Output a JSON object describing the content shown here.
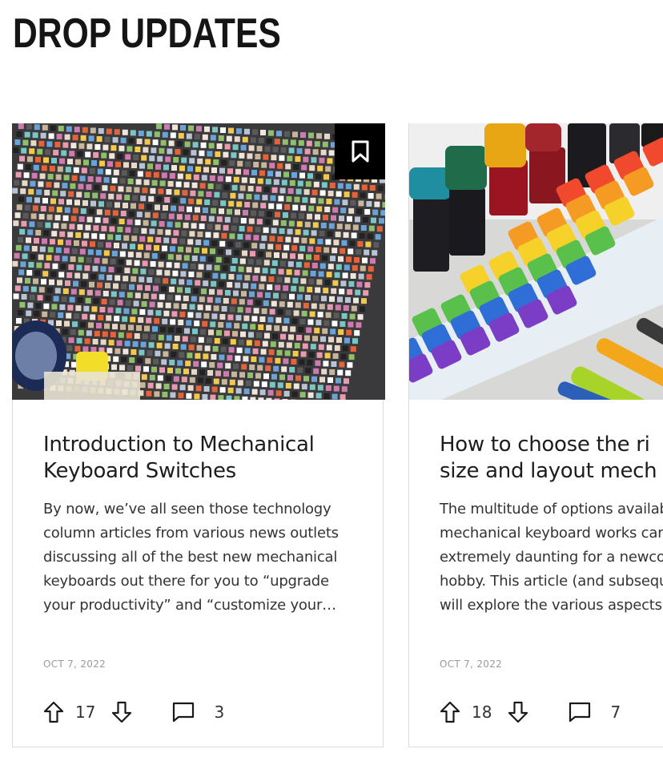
{
  "section": {
    "title": "DROP UPDATES"
  },
  "cards": [
    {
      "title": "Introduction to Mechanical Keyboard Switches",
      "excerpt": "By now, we’ve all seen those technology column articles from various news outlets discussing all of the best new mechanical keyboards out there for you to “upgrade your productivity” and “customize your…",
      "date": "OCT 7, 2022",
      "upvotes": "17",
      "comments": "3",
      "image_icon": "bookmark-icon"
    },
    {
      "title_line1": "How to choose the ri",
      "title_line2": "size and layout mech",
      "excerpt_lines": [
        "The multitude of options availab",
        "mechanical keyboard works can",
        "extremely daunting for a newco",
        "hobby. This article (and subsequ",
        "will explore the various aspects"
      ],
      "date": "OCT 7, 2022",
      "upvotes": "18",
      "comments": "7"
    }
  ],
  "colors": {
    "text_dark": "#1d1d1d",
    "border": "#dcdcdc",
    "bookmark_bg": "#000000",
    "date_gray": "#9a9a9a"
  }
}
